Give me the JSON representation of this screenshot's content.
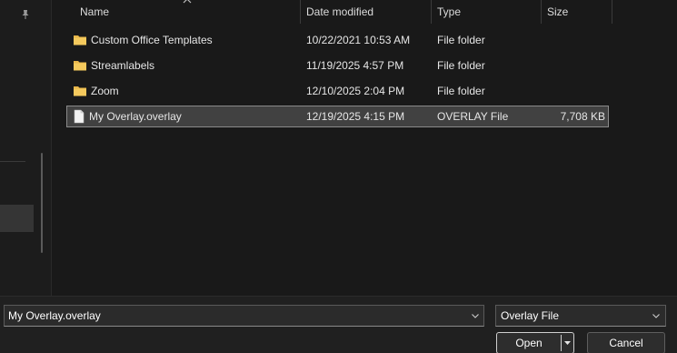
{
  "nav": {
    "pin_icon": "pin-icon"
  },
  "columns": {
    "name": "Name",
    "date": "Date modified",
    "type": "Type",
    "size": "Size"
  },
  "rows": [
    {
      "name": "Custom Office Templates",
      "date": "10/22/2021 10:53 AM",
      "type": "File folder",
      "size": "",
      "icon": "folder-icon"
    },
    {
      "name": "Streamlabels",
      "date": "11/19/2025 4:57 PM",
      "type": "File folder",
      "size": "",
      "icon": "folder-icon"
    },
    {
      "name": "Zoom",
      "date": "12/10/2025 2:04 PM",
      "type": "File folder",
      "size": "",
      "icon": "folder-icon"
    },
    {
      "name": "My Overlay.overlay",
      "date": "12/19/2025 4:15 PM",
      "type": "OVERLAY File",
      "size": "7,708 KB",
      "icon": "file-icon",
      "selected": true
    }
  ],
  "file_name": {
    "value": "My Overlay.overlay"
  },
  "file_type": {
    "value": "Overlay File"
  },
  "buttons": {
    "open": "Open",
    "cancel": "Cancel"
  },
  "colors": {
    "folder": "#e8b64a",
    "selection": "#414141",
    "background": "#191919"
  }
}
